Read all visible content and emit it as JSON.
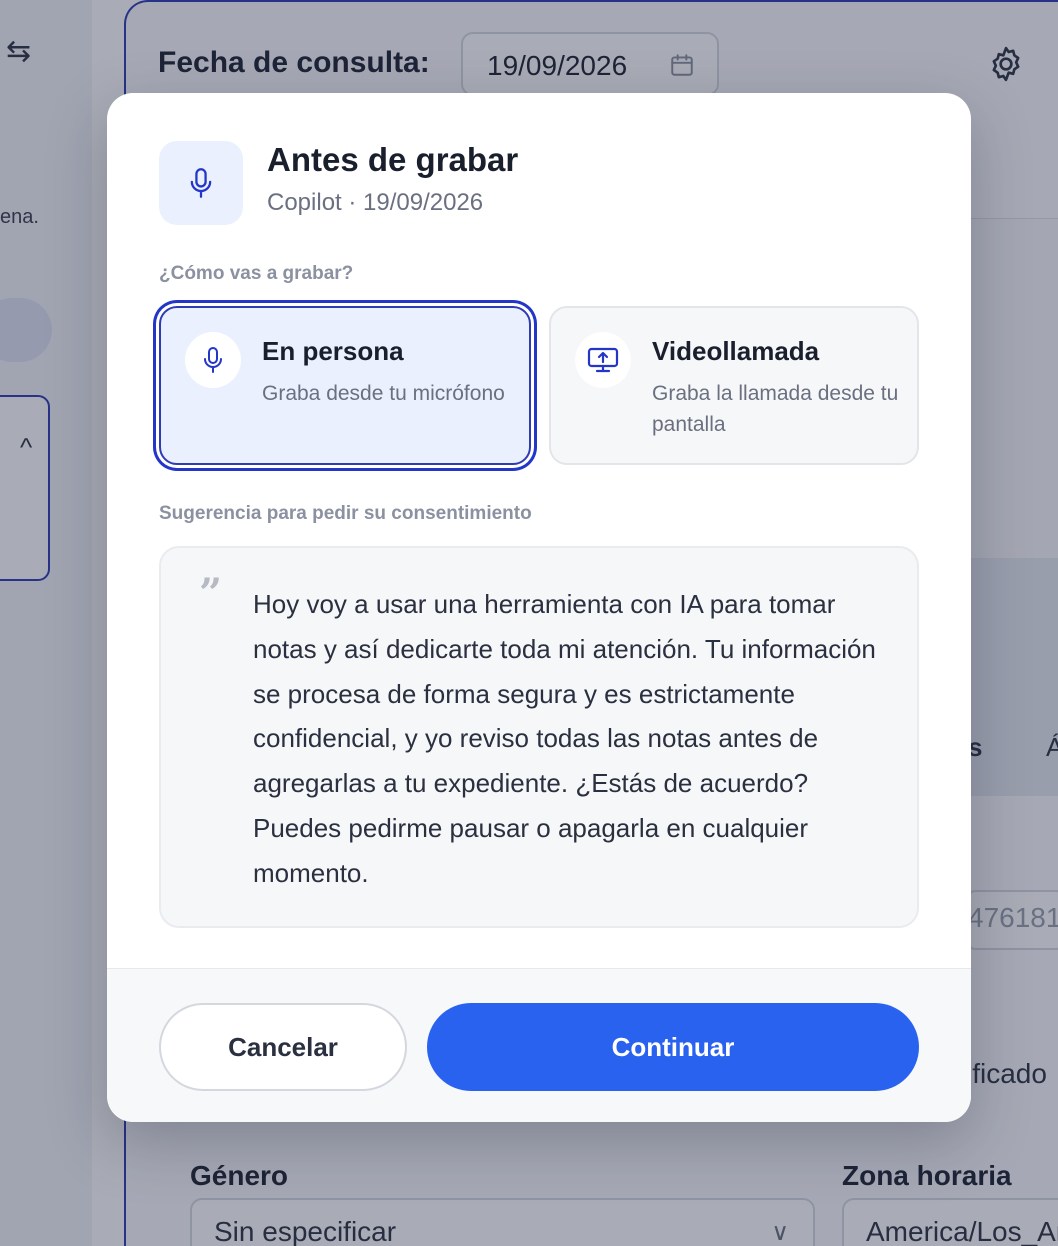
{
  "background": {
    "left_truncated_text": "ena.",
    "fecha_label": "Fecha de consulta:",
    "fecha_value": "19/09/2026",
    "right_partial_s": "s",
    "right_partial_a": "Á",
    "right_partial_number": "476181",
    "right_partial_ificado": "ificado",
    "genero_label": "Género",
    "genero_value": "Sin especificar",
    "zona_label": "Zona horaria",
    "zona_value": "America/Los_An"
  },
  "modal": {
    "title": "Antes de grabar",
    "subtitle": "Copilot · 19/09/2026",
    "record_question": "¿Cómo vas a grabar?",
    "options": [
      {
        "title": "En persona",
        "description": "Graba desde tu micrófono",
        "icon": "microphone-icon",
        "selected": true
      },
      {
        "title": "Videollamada",
        "description": "Graba la llamada desde tu pantalla",
        "icon": "screen-share-icon",
        "selected": false
      }
    ],
    "consent_label": "Sugerencia para pedir su consentimiento",
    "quote_mark": "”",
    "consent_text": "Hoy voy a usar una herramienta con IA para tomar notas y así dedicarte toda mi atención. Tu información se procesa de forma segura y es estrictamente confidencial, y yo reviso todas las notas antes de agregarlas a tu expediente. ¿Estás de acuerdo? Puedes pedirme pausar o apagarla en cualquier momento.",
    "cancel_label": "Cancelar",
    "continue_label": "Continuar"
  },
  "colors": {
    "primary": "#2a62f0",
    "selected_border": "#2336c8",
    "icon_blue": "#2336c8",
    "selected_bg": "#eaf0fd",
    "overlay": "rgba(30,38,64,0.38)"
  }
}
